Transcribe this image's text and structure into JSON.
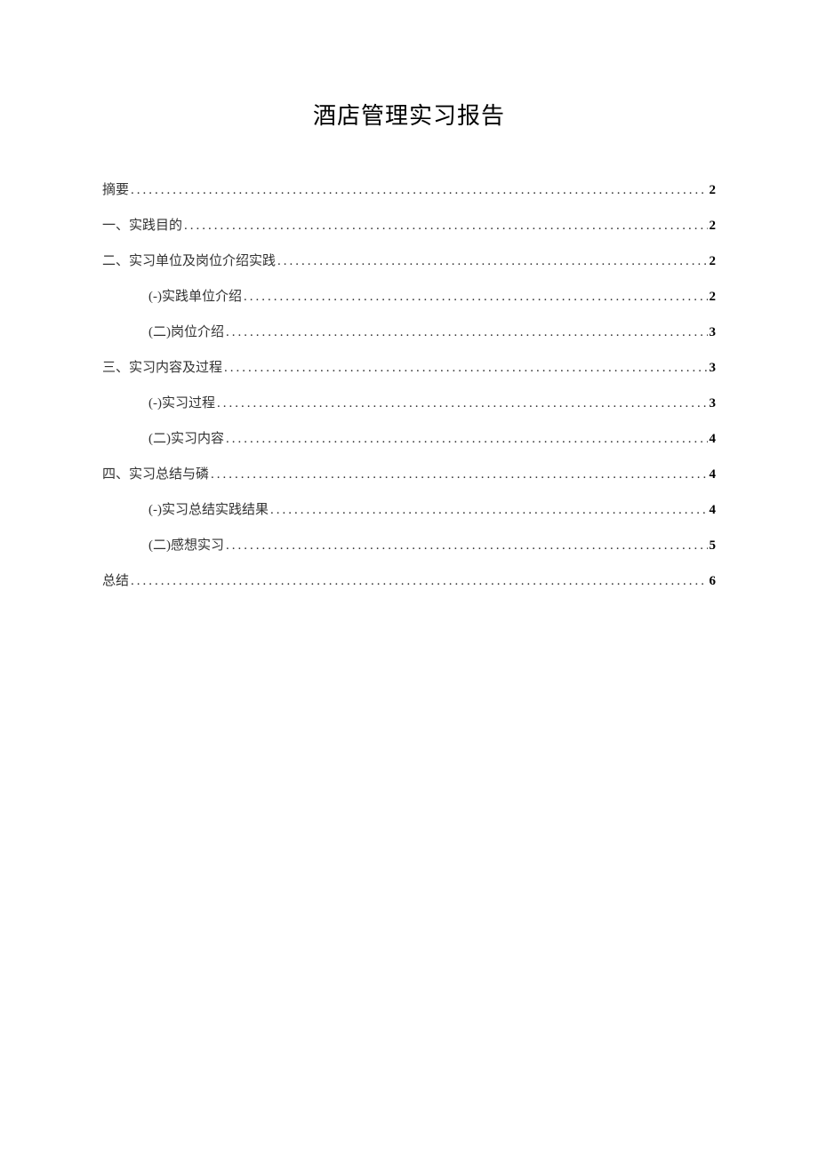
{
  "title": "酒店管理实习报告",
  "toc": {
    "items": [
      {
        "label": "摘要",
        "page": "2",
        "sub": false
      },
      {
        "label": "一、实践目的",
        "page": "2",
        "sub": false
      },
      {
        "label": "二、实习单位及岗位介绍实践",
        "page": "2",
        "sub": false
      },
      {
        "label": "(-)实践单位介绍",
        "page": "2",
        "sub": true
      },
      {
        "label": "(二)岗位介绍",
        "page": "3",
        "sub": true
      },
      {
        "label": "三、实习内容及过程",
        "page": "3",
        "sub": false
      },
      {
        "label": "(-)实习过程",
        "page": "3",
        "sub": true
      },
      {
        "label": "(二)实习内容",
        "page": "4",
        "sub": true
      },
      {
        "label": "四、实习总结与磷",
        "page": "4",
        "sub": false
      },
      {
        "label": "(-)实习总结实践结果",
        "page": "4",
        "sub": true
      },
      {
        "label": "(二)感想实习",
        "page": "5",
        "sub": true
      },
      {
        "label": "总结",
        "page": "6",
        "sub": false
      }
    ]
  }
}
